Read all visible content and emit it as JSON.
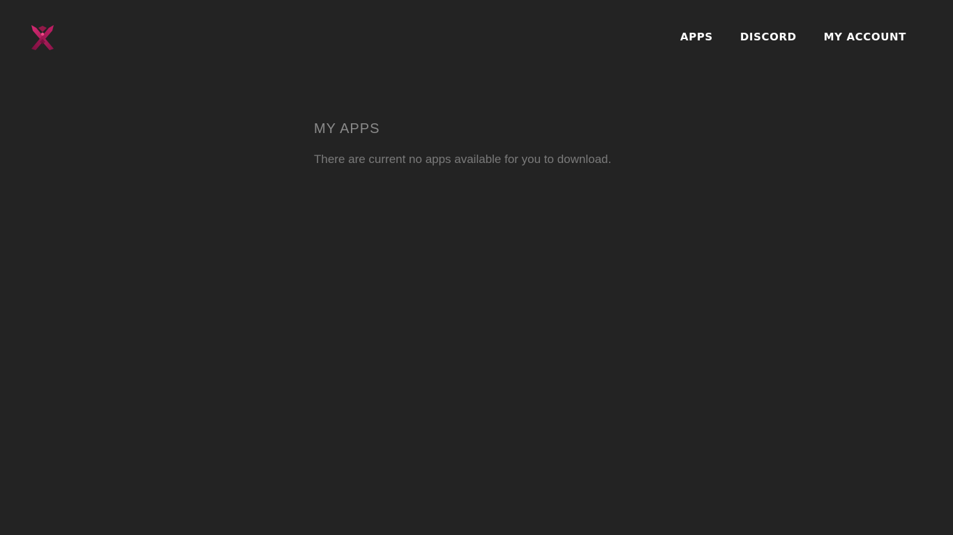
{
  "header": {
    "logo": {
      "icon": "x-logo-icon",
      "colors": {
        "primary": "#b0195e",
        "highlight": "#e8407e"
      }
    },
    "nav": [
      {
        "label": "APPS"
      },
      {
        "label": "DISCORD"
      },
      {
        "label": "MY ACCOUNT"
      }
    ]
  },
  "main": {
    "title": "MY APPS",
    "empty_message": "There are current no apps available for you to download."
  },
  "colors": {
    "background": "#232323",
    "nav_text": "#ffffff",
    "title_text": "#8a8a8a",
    "body_text": "#7a7a7a"
  }
}
